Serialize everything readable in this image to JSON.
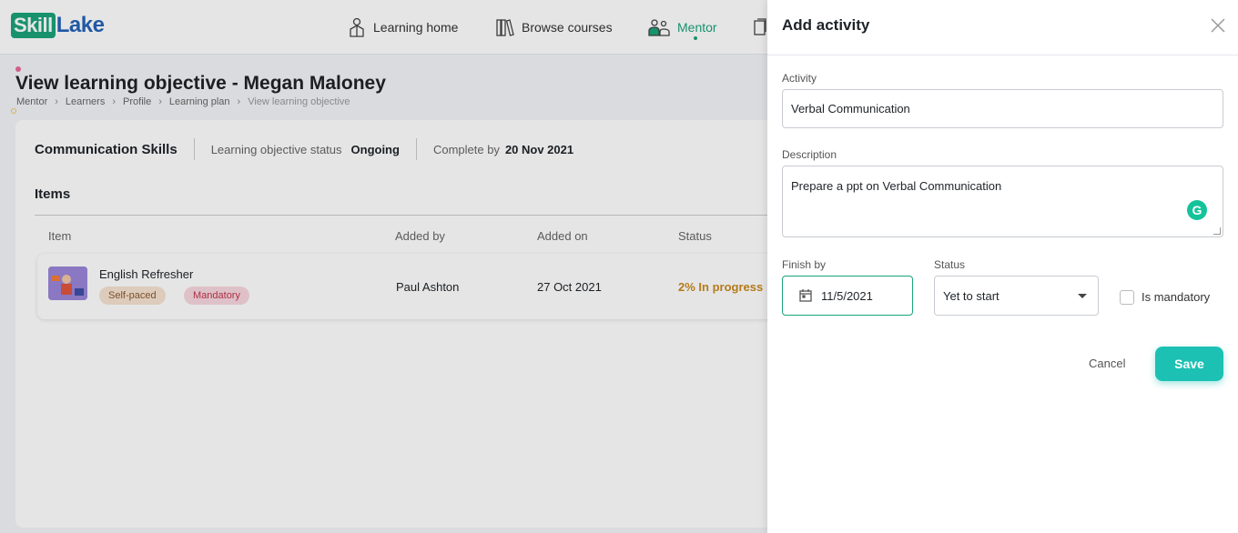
{
  "header": {
    "logo": {
      "part1": "Skill",
      "part2": "Lake"
    },
    "nav": [
      {
        "label": "Learning home",
        "icon": "learning-home-icon"
      },
      {
        "label": "Browse courses",
        "icon": "books-icon"
      },
      {
        "label": "Mentor",
        "icon": "mentor-icon",
        "active": true
      }
    ]
  },
  "page": {
    "title": "View learning objective - Megan Maloney",
    "breadcrumb": [
      "Mentor",
      "Learners",
      "Profile",
      "Learning plan",
      "View learning objective"
    ],
    "objective": {
      "name": "Communication Skills",
      "status_label": "Learning objective status",
      "status_value": "Ongoing",
      "complete_label": "Complete by",
      "complete_value": "20 Nov 2021"
    },
    "items_title": "Items",
    "columns": [
      "Item",
      "Added by",
      "Added on",
      "Status"
    ],
    "rows": [
      {
        "name": "English Refresher",
        "tags": [
          "Self-paced",
          "Mandatory"
        ],
        "added_by": "Paul Ashton",
        "added_on": "27 Oct 2021",
        "status": "2% In progress"
      }
    ]
  },
  "drawer": {
    "title": "Add activity",
    "activity_label": "Activity",
    "activity_value": "Verbal Communication",
    "description_label": "Description",
    "description_value": "Prepare a ppt on Verbal Communication",
    "grammarly_glyph": "G",
    "finish_label": "Finish by",
    "finish_value": "11/5/2021",
    "status_label": "Status",
    "status_value": "Yet to start",
    "mandatory_label": "Is mandatory",
    "cancel_label": "Cancel",
    "save_label": "Save"
  },
  "colors": {
    "accent": "#1aa37a",
    "save": "#1cc1b4",
    "in_progress": "#c98a1e",
    "mandatory": "#c0344d"
  }
}
